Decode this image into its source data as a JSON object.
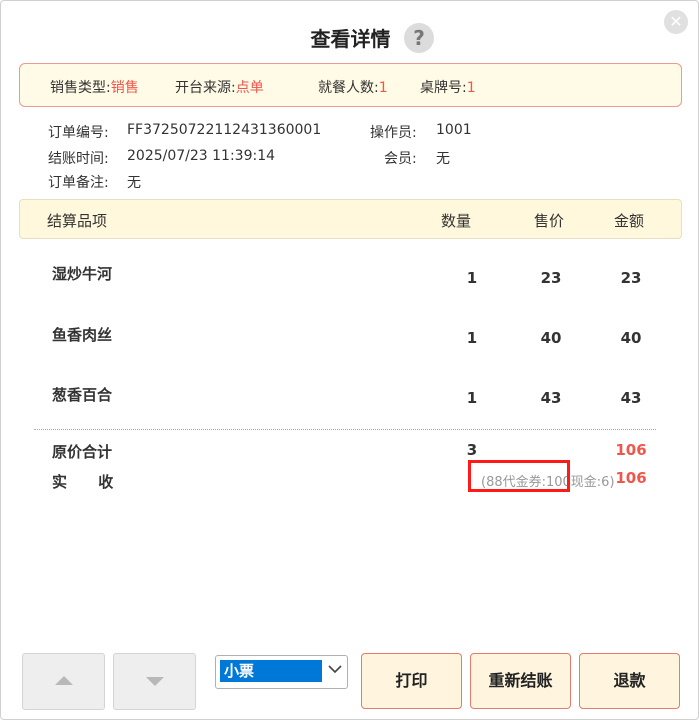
{
  "dialog": {
    "title": "查看详情",
    "help_icon": "question-circle-icon",
    "close_icon": "close-x-icon"
  },
  "info_bar": {
    "sale_type_label": "销售类型:",
    "sale_type_value": "销售",
    "source_label": "开台来源:",
    "source_value": "点单",
    "guests_label": "就餐人数:",
    "guests_value": "1",
    "table_label": "桌牌号:",
    "table_value": "1"
  },
  "order": {
    "order_no_label": "订单编号:",
    "order_no": "FF37250722112431360001",
    "operator_label": "操作员:",
    "operator": "1001",
    "checkout_time_label": "结账时间:",
    "checkout_time": "2025/07/23 11:39:14",
    "member_label": "会员:",
    "member": "无",
    "remark_label": "订单备注:",
    "remark": "无"
  },
  "table": {
    "headers": {
      "item": "结算品项",
      "qty": "数量",
      "price": "售价",
      "amount": "金额"
    },
    "rows": [
      {
        "name": "湿炒牛河",
        "qty": "1",
        "price": "23",
        "amount": "23"
      },
      {
        "name": "鱼香肉丝",
        "qty": "1",
        "price": "40",
        "amount": "40"
      },
      {
        "name": "葱香百合",
        "qty": "1",
        "price": "43",
        "amount": "43"
      }
    ]
  },
  "totals": {
    "original_label": "原价合计",
    "original_qty": "3",
    "original_amount": "106",
    "received_label": "实 收",
    "received_detail": "(88代金券:100现金:6)",
    "received_amount": "106"
  },
  "footer": {
    "up_icon": "triangle-up-icon",
    "down_icon": "triangle-down-icon",
    "print_type_selected": "小票",
    "print_label": "打印",
    "recheckout_label": "重新结账",
    "refund_label": "退款"
  },
  "colors": {
    "accent_red": "#f2564b",
    "header_bg": "#fff8dc",
    "info_bg": "#fffbe6",
    "highlight": "#ff1a1a"
  }
}
